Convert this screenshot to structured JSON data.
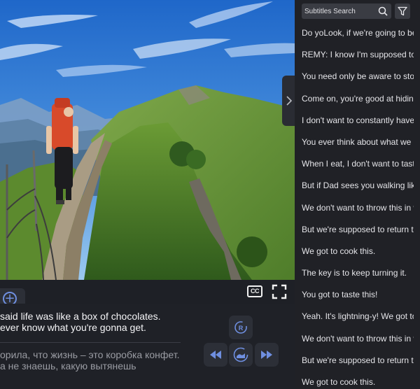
{
  "subtitles": {
    "english": "said life was like a box of chocolates.\never know what you're gonna get.",
    "russian": "орила, что жизнь – это коробка конфет.\nа не знаешь, какую вытянешь"
  },
  "controls": {
    "cc_label": "CC",
    "repeat_label": "R"
  },
  "sidebar": {
    "search_placeholder": "Subtitles Search",
    "items": [
      "Do yoLook, if we're going to be t",
      "REMY: I know I'm supposed to h",
      "You need only be aware to stop",
      "Come on, you're good at hiding f",
      "I don't want to constantly have t",
      "You ever think about what we pu",
      "When I eat, I don't want to taste",
      "But if Dad sees you walking like",
      "We don't want to throw this in w",
      "But we're supposed to return to",
      "We got to cook this.",
      "The key is to keep turning it.",
      "You got to taste this!",
      "Yeah. It's lightning-y! We got to c",
      "We don't want to throw this in w",
      "But we're supposed to return to",
      "We got to cook this."
    ]
  },
  "icons": {
    "add": "plus-circle-icon",
    "cc": "closed-captions-icon",
    "fullscreen": "fullscreen-icon",
    "repeat": "repeat-icon",
    "prev": "rewind-icon",
    "loop": "loop-icon",
    "next": "fast-forward-icon",
    "search": "search-icon",
    "filter": "filter-icon",
    "collapse": "chevron-right-icon"
  },
  "colors": {
    "accent": "#6f8fe0",
    "panel": "#1f2127",
    "button": "#2c2f37"
  }
}
